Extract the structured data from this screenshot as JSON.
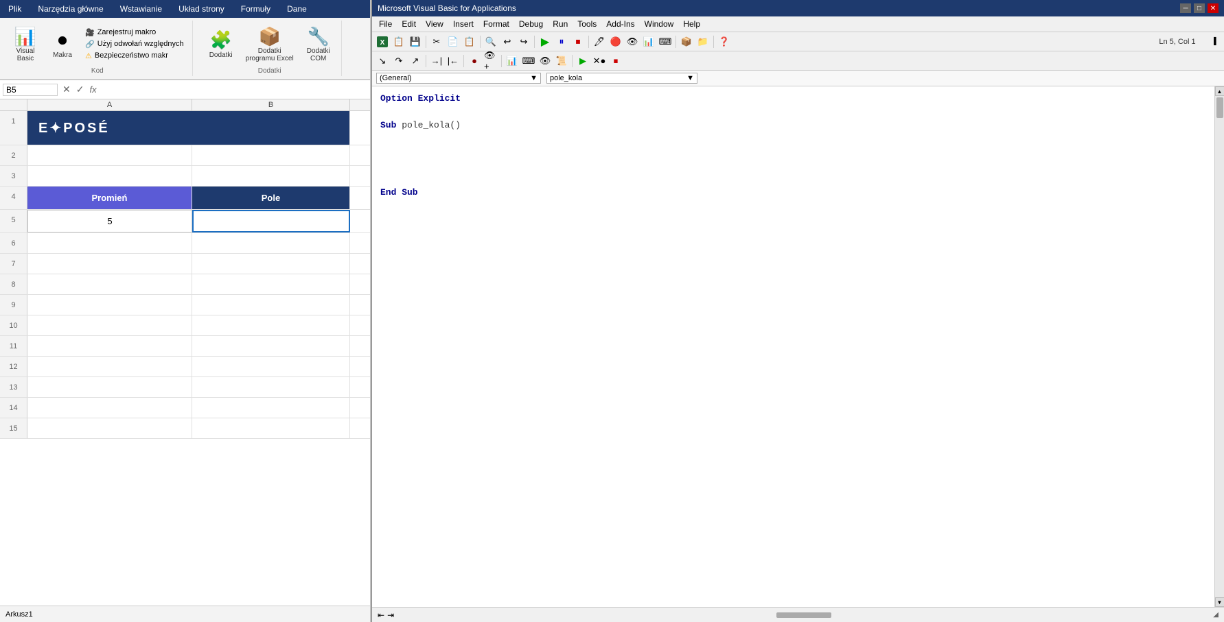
{
  "excel": {
    "menu_items": [
      "Plik",
      "Narzędzia główne",
      "Wstawianie",
      "Układ strony",
      "Formuły",
      "Dane"
    ],
    "ribbon": {
      "groups": [
        {
          "name": "Kod",
          "buttons": [
            {
              "label": "Visual\nBasic",
              "icon": "📄"
            },
            {
              "label": "Makra",
              "icon": "⏺"
            }
          ],
          "small_buttons": [
            {
              "label": "Zarejestruj makro",
              "icon": "📹"
            },
            {
              "label": "Użyj odwołań względnych",
              "icon": "🔗"
            },
            {
              "label": "Bezpieczeństwo makr",
              "icon": "⚠"
            }
          ]
        },
        {
          "name": "Dodatki",
          "buttons": [
            {
              "label": "Dodatki",
              "icon": "🧩"
            },
            {
              "label": "Dodatki\nprogramu Excel",
              "icon": "📦"
            },
            {
              "label": "Dodatki\nCOM",
              "icon": "🔧"
            }
          ]
        }
      ]
    },
    "formula_bar": {
      "cell_ref": "B5",
      "formula": ""
    },
    "columns": [
      "A",
      "B"
    ],
    "rows": [
      {
        "num": 1,
        "cells": [
          {
            "value": "EXPOSÉ",
            "colspan": 2,
            "style": "logo"
          },
          {
            "value": ""
          }
        ]
      },
      {
        "num": 2,
        "cells": [
          {
            "value": ""
          },
          {
            "value": ""
          }
        ]
      },
      {
        "num": 3,
        "cells": [
          {
            "value": ""
          },
          {
            "value": ""
          }
        ]
      },
      {
        "num": 4,
        "cells": [
          {
            "value": "Promień",
            "style": "header-promien"
          },
          {
            "value": "Pole",
            "style": "header-pole"
          }
        ]
      },
      {
        "num": 5,
        "cells": [
          {
            "value": "5",
            "style": "data"
          },
          {
            "value": "",
            "style": "data selected"
          }
        ]
      },
      {
        "num": 6,
        "cells": [
          {
            "value": ""
          },
          {
            "value": ""
          }
        ]
      },
      {
        "num": 7,
        "cells": [
          {
            "value": ""
          },
          {
            "value": ""
          }
        ]
      },
      {
        "num": 8,
        "cells": [
          {
            "value": ""
          },
          {
            "value": ""
          }
        ]
      },
      {
        "num": 9,
        "cells": [
          {
            "value": ""
          },
          {
            "value": ""
          }
        ]
      },
      {
        "num": 10,
        "cells": [
          {
            "value": ""
          },
          {
            "value": ""
          }
        ]
      },
      {
        "num": 11,
        "cells": [
          {
            "value": ""
          },
          {
            "value": ""
          }
        ]
      },
      {
        "num": 12,
        "cells": [
          {
            "value": ""
          },
          {
            "value": ""
          }
        ]
      },
      {
        "num": 13,
        "cells": [
          {
            "value": ""
          },
          {
            "value": ""
          }
        ]
      },
      {
        "num": 14,
        "cells": [
          {
            "value": ""
          },
          {
            "value": ""
          }
        ]
      },
      {
        "num": 15,
        "cells": [
          {
            "value": ""
          },
          {
            "value": ""
          }
        ]
      }
    ]
  },
  "vba": {
    "title": "Microsoft Visual Basic for Applications",
    "menu_items": [
      "File",
      "Edit",
      "View",
      "Insert",
      "Format",
      "Debug",
      "Run",
      "Tools",
      "Add-Ins",
      "Window",
      "Help"
    ],
    "status": {
      "ln_col": "Ln 5, Col 1"
    },
    "dropdowns": {
      "general": "(General)",
      "procedure": "pole_kola"
    },
    "code_lines": [
      {
        "text": "Option Explicit",
        "type": "keyword"
      },
      {
        "text": "",
        "type": "normal"
      },
      {
        "text": "Sub pole_kola()",
        "type": "sub"
      },
      {
        "text": "",
        "type": "normal"
      },
      {
        "text": "",
        "type": "normal"
      },
      {
        "text": "",
        "type": "normal"
      },
      {
        "text": "",
        "type": "normal"
      },
      {
        "text": "End Sub",
        "type": "keyword"
      }
    ]
  }
}
